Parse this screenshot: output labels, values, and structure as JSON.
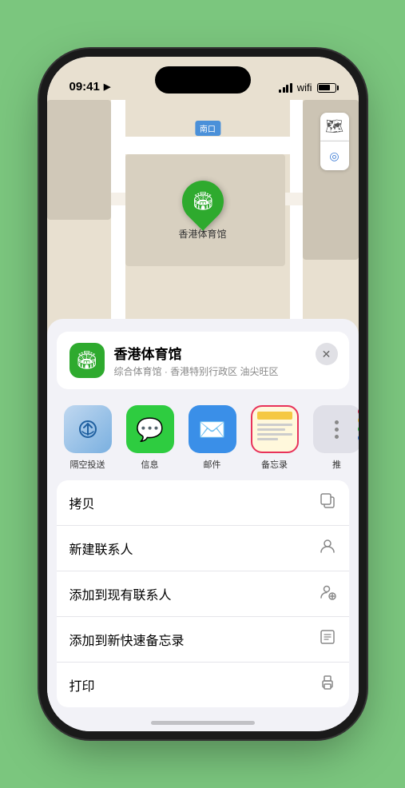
{
  "status_bar": {
    "time": "09:41",
    "location_arrow": "▶"
  },
  "map": {
    "label": "南口",
    "venue_name": "香港体育馆",
    "venue_icon": "🏟"
  },
  "map_controls": {
    "map_icon": "🗺",
    "location_icon": "⌖"
  },
  "location_card": {
    "name": "香港体育馆",
    "subtitle": "综合体育馆 · 香港特别行政区 油尖旺区",
    "close_label": "✕"
  },
  "share_apps": [
    {
      "id": "airdrop",
      "label": "隔空投送"
    },
    {
      "id": "messages",
      "label": "信息"
    },
    {
      "id": "mail",
      "label": "邮件"
    },
    {
      "id": "notes",
      "label": "备忘录"
    }
  ],
  "action_items": [
    {
      "id": "copy",
      "label": "拷贝",
      "icon": "⧉"
    },
    {
      "id": "new-contact",
      "label": "新建联系人",
      "icon": "👤"
    },
    {
      "id": "add-existing",
      "label": "添加到现有联系人",
      "icon": "👤"
    },
    {
      "id": "quick-note",
      "label": "添加到新快速备忘录",
      "icon": "⊞"
    },
    {
      "id": "print",
      "label": "打印",
      "icon": "🖨"
    }
  ]
}
